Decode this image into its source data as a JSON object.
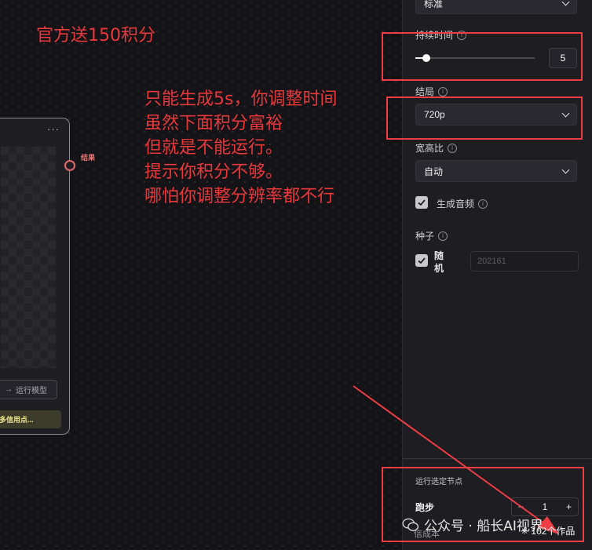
{
  "annotations": {
    "top_note": "官方送150积分",
    "lines": [
      "只能生成5s，你调整时间",
      "虽然下面积分富裕",
      "但就是不能运行。",
      "提示你积分不够。",
      "哪怕你调整分辨率都不行"
    ]
  },
  "node": {
    "menu": "···",
    "run_button": "运行模型",
    "credit_warning": "多信用点",
    "output_label": "结果"
  },
  "panel": {
    "top_select_value": "标准",
    "duration": {
      "label": "持续时间",
      "value": "5",
      "slider_fraction": 0.09
    },
    "resolution": {
      "label": "结局",
      "value": "720p"
    },
    "aspect": {
      "label": "宽高比",
      "value": "自动"
    },
    "audio": {
      "label": "生成音频",
      "checked": true
    },
    "seed": {
      "label": "种子",
      "random_label_1": "随",
      "random_label_2": "机",
      "placeholder": "202161",
      "checked": true
    },
    "run_selected": {
      "title": "运行选定节点",
      "row_label": "跑步",
      "count": "1",
      "minus": "−",
      "plus": "+",
      "cost_label": "信成本"
    }
  },
  "watermark": {
    "text": "公众号 · 船长AI视界",
    "works": "102个作品"
  },
  "colors": {
    "annotation_red": "#e8383a",
    "box_red": "#ee3e44"
  }
}
